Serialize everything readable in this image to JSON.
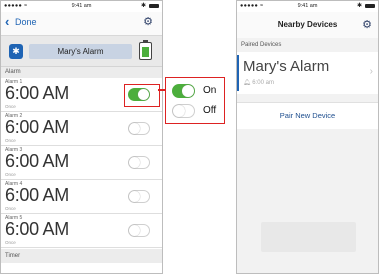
{
  "left_phone": {
    "status_bar": {
      "signal": "●●●●● ≈",
      "time": "9:41 am",
      "bt": "✱"
    },
    "nav": {
      "back_label": "Done",
      "back_icon": "chevron-left",
      "settings_icon": "gear"
    },
    "device": {
      "name": "Mary's Alarm",
      "bt_glyph": "✱"
    },
    "alarm_section_label": "Alarm",
    "alarms": [
      {
        "label": "Alarm 1",
        "time": "6:00 AM",
        "repeat": "Once",
        "enabled": true
      },
      {
        "label": "Alarm 2",
        "time": "6:00 AM",
        "repeat": "Once",
        "enabled": false
      },
      {
        "label": "Alarm 3",
        "time": "6:00 AM",
        "repeat": "Once",
        "enabled": false
      },
      {
        "label": "Alarm 4",
        "time": "6:00 AM",
        "repeat": "Once",
        "enabled": false
      },
      {
        "label": "Alarm 5",
        "time": "6:00 AM",
        "repeat": "Once",
        "enabled": false
      }
    ],
    "timer_section_label": "Timer"
  },
  "legend": {
    "on_label": "On",
    "off_label": "Off"
  },
  "right_phone": {
    "status_bar": {
      "signal": "●●●●● ≈",
      "time": "9:41 am",
      "bt": "✱"
    },
    "nav_title": "Nearby Devices",
    "paired_label": "Paired Devices",
    "device": {
      "name": "Mary's Alarm",
      "alarm_time": "6:00 am",
      "chevron": "›",
      "bell": "🔔︎"
    },
    "pair_new_label": "Pair New Device"
  },
  "colors": {
    "accent_blue": "#1f64b4",
    "toggle_on": "#4cae3c",
    "highlight_red": "#dd2222"
  }
}
